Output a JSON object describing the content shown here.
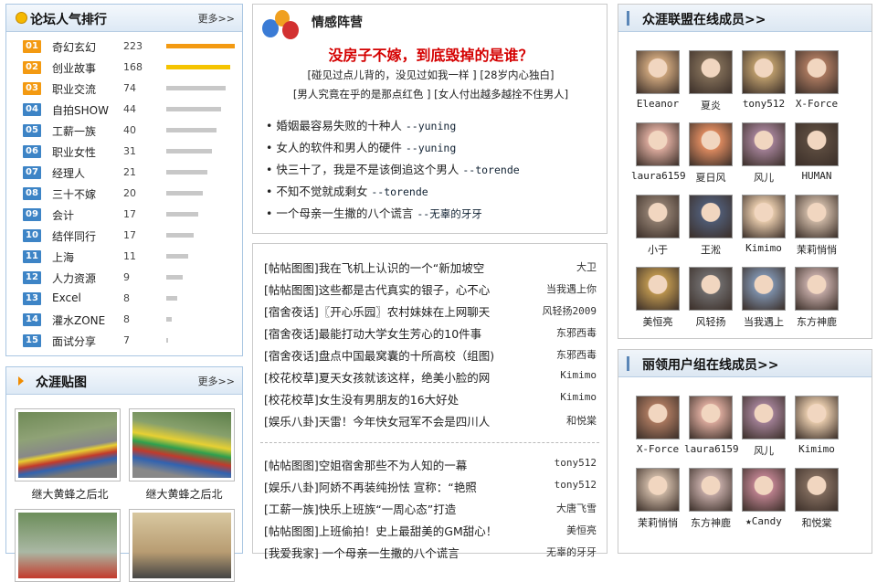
{
  "ranking": {
    "title": "论坛人气排行",
    "more": "更多>>",
    "items": [
      {
        "rank": "01",
        "name": "奇幻玄幻",
        "count": "223",
        "level": 1.0
      },
      {
        "rank": "02",
        "name": "创业故事",
        "count": "168",
        "level": 0.93
      },
      {
        "rank": "03",
        "name": "职业交流",
        "count": "74",
        "level": 0.87
      },
      {
        "rank": "04",
        "name": "自拍SHOW",
        "count": "44",
        "level": 0.8
      },
      {
        "rank": "05",
        "name": "工薪一族",
        "count": "40",
        "level": 0.73
      },
      {
        "rank": "06",
        "name": "职业女性",
        "count": "31",
        "level": 0.67
      },
      {
        "rank": "07",
        "name": "经理人",
        "count": "21",
        "level": 0.6
      },
      {
        "rank": "08",
        "name": "三十不嫁",
        "count": "20",
        "level": 0.53
      },
      {
        "rank": "09",
        "name": "会计",
        "count": "17",
        "level": 0.46
      },
      {
        "rank": "10",
        "name": "结伴同行",
        "count": "17",
        "level": 0.4
      },
      {
        "rank": "11",
        "name": "上海",
        "count": "11",
        "level": 0.32
      },
      {
        "rank": "12",
        "name": "人力资源",
        "count": "9",
        "level": 0.24
      },
      {
        "rank": "13",
        "name": "Excel",
        "count": "8",
        "level": 0.16
      },
      {
        "rank": "14",
        "name": "灌水ZONE",
        "count": "8",
        "level": 0.08
      },
      {
        "rank": "15",
        "name": "面试分享",
        "count": "7",
        "level": 0.02
      }
    ]
  },
  "photos": {
    "title": "众涯贴图",
    "more": "更多>>",
    "items": [
      {
        "caption": "继大黄蜂之后北"
      },
      {
        "caption": "继大黄蜂之后北"
      }
    ]
  },
  "emotion": {
    "title": "情感阵营",
    "headline": "没房子不嫁，到底毁掉的是谁？",
    "sub1": "[碰见过点儿背的，没见过如我一样 ] [28岁内心独白]",
    "sub2": "[男人究竟在乎的是那点红色 ] [女人付出越多越拴不住男人]",
    "items": [
      {
        "text": "婚姻最容易失败的十种人",
        "author": "--yuning"
      },
      {
        "text": "女人的软件和男人的硬件",
        "author": "--yuning"
      },
      {
        "text": "快三十了，我是不是该倒追这个男人",
        "author": "--torende"
      },
      {
        "text": "不知不觉就成剩女",
        "author": "--torende"
      },
      {
        "text": "一个母亲一生撒的八个谎言",
        "author": "--无辜的牙牙"
      }
    ]
  },
  "posts1": [
    {
      "title": "[帖帖图图]我在飞机上认识的一个“新加坡空",
      "author": "大卫"
    },
    {
      "title": "[帖帖图图]这些都是古代真实的银子，心不心",
      "author": "当我遇上你"
    },
    {
      "title": "[宿舍夜话]〖开心乐园〗农村妹妹在上网聊天",
      "author": "风轻扬2009"
    },
    {
      "title": "[宿舍夜话]最能打动大学女生芳心的10件事",
      "author": "东邪西毒"
    },
    {
      "title": "[宿舍夜话]盘点中国最窝囊的十所高校（组图)",
      "author": "东邪西毒"
    },
    {
      "title": "[校花校草]夏天女孩就该这样，绝美小脸的网",
      "author": "Kimimo"
    },
    {
      "title": "[校花校草]女生没有男朋友的16大好处",
      "author": "Kimimo"
    },
    {
      "title": "[娱乐八卦]天雷！今年快女冠军不会是四川人",
      "author": "和悦棠"
    }
  ],
  "posts2": [
    {
      "title": "[帖帖图图]空姐宿舍那些不为人知的一幕",
      "author": "tony512"
    },
    {
      "title": "[娱乐八卦]阿娇不再装纯扮怯 宣称：“艳照",
      "author": "tony512"
    },
    {
      "title": "[工薪一族]快乐上班族“一周心态”打造",
      "author": "大唐飞雪"
    },
    {
      "title": "[帖帖图图]上班偷拍！史上最甜美的GM甜心！",
      "author": "美恒亮"
    },
    {
      "title": "[我爱我家] 一个母亲一生撒的八个谎言",
      "author": "无辜的牙牙"
    }
  ],
  "members1": {
    "title": "众涯联盟在线成员>>",
    "items": [
      {
        "name": "Eleanor",
        "color": "#c9a27a"
      },
      {
        "name": "夏炎",
        "color": "#7d6a55"
      },
      {
        "name": "tony512",
        "color": "#b99a6a"
      },
      {
        "name": "X-Force",
        "color": "#a8775e"
      },
      {
        "name": "laura6159",
        "color": "#d7a79a"
      },
      {
        "name": "夏日风",
        "color": "#d9885e"
      },
      {
        "name": "风儿",
        "color": "#9f7e93"
      },
      {
        "name": "HUMAN",
        "color": "#5a4a3e"
      },
      {
        "name": "小于",
        "color": "#8c7a6c"
      },
      {
        "name": "王淞",
        "color": "#4f5a72"
      },
      {
        "name": "Kimimo",
        "color": "#e2c6a8"
      },
      {
        "name": "茉莉悄悄",
        "color": "#c7b2a0"
      },
      {
        "name": "美恒亮",
        "color": "#b9934e"
      },
      {
        "name": "风轻扬",
        "color": "#6d6a6a"
      },
      {
        "name": "当我遇上",
        "color": "#7c8ea8"
      },
      {
        "name": "东方神鹿",
        "color": "#bfa6a2"
      }
    ]
  },
  "members2": {
    "title": "丽领用户组在线成员>>",
    "items": [
      {
        "name": "X-Force",
        "color": "#a8775e"
      },
      {
        "name": "laura6159",
        "color": "#d7a79a"
      },
      {
        "name": "风儿",
        "color": "#9f7e93"
      },
      {
        "name": "Kimimo",
        "color": "#e2c6a8"
      },
      {
        "name": "茉莉悄悄",
        "color": "#c7b2a0"
      },
      {
        "name": "东方神鹿",
        "color": "#bfa6a2"
      },
      {
        "name": "★Candy",
        "color": "#b97f8c"
      },
      {
        "name": "和悦棠",
        "color": "#7f6a5c"
      }
    ]
  },
  "colors": {
    "accent_orange": "#f39a12",
    "badge_blue": "#3d84c6",
    "headline_red": "#d40000"
  }
}
